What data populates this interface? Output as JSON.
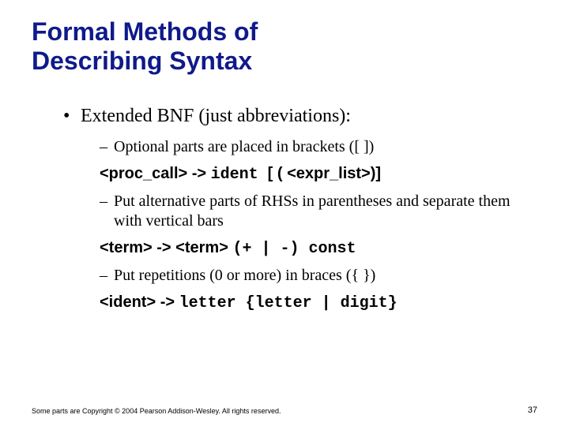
{
  "title_line1": "Formal Methods of",
  "title_line2": "Describing Syntax",
  "lvl1_text": "Extended BNF (just abbreviations):",
  "sub1": "Optional parts are placed in brackets ([ ])",
  "code1_a": "<proc_call> -> ",
  "code1_b": "ident ",
  "code1_c": "[ ( <expr_list>)]",
  "sub2": "Put alternative parts of RHSs in parentheses and separate them with vertical bars",
  "code2_a": "<term> -> <term> ",
  "code2_b": "(+ | -) const",
  "sub3": "Put repetitions (0 or more) in braces ({ })",
  "code3_a": "<ident> -> ",
  "code3_b": "letter {letter | digit}",
  "footer": "Some parts are Copyright © 2004 Pearson Addison-Wesley. All rights reserved.",
  "page": "37",
  "bullets": {
    "dot": "•",
    "dash": "–"
  }
}
